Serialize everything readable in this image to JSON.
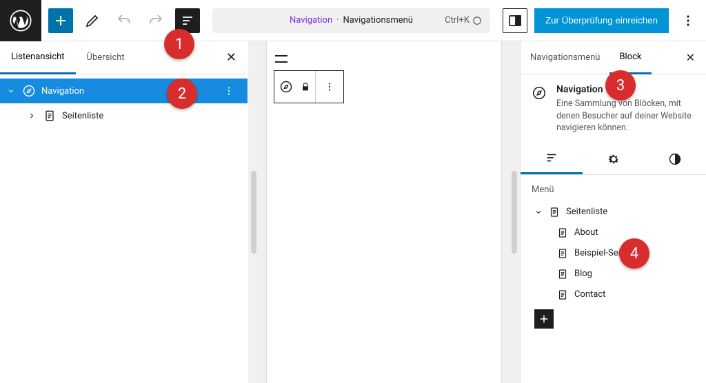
{
  "topbar": {
    "command_crumb": "Navigation",
    "command_current": "Navigationsmenü",
    "shortcut": "Ctrl+K",
    "review_label": "Zur Überprüfung einreichen"
  },
  "left": {
    "tabs": {
      "list": "Listenansicht",
      "outline": "Übersicht"
    },
    "tree": {
      "root": "Navigation",
      "child": "Seitenliste"
    }
  },
  "right": {
    "tabs": {
      "menu": "Navigationsmenü",
      "block": "Block"
    },
    "block_card": {
      "title": "Navigation",
      "desc": "Eine Sammlung von Blöcken, mit denen Besucher auf deiner Website navigieren können."
    },
    "menu_heading": "Menü",
    "menu": {
      "root": "Seitenliste",
      "items": [
        "About",
        "Beispiel-Seite",
        "Blog",
        "Contact"
      ]
    }
  },
  "badges": {
    "b1": "1",
    "b2": "2",
    "b3": "3",
    "b4": "4"
  }
}
